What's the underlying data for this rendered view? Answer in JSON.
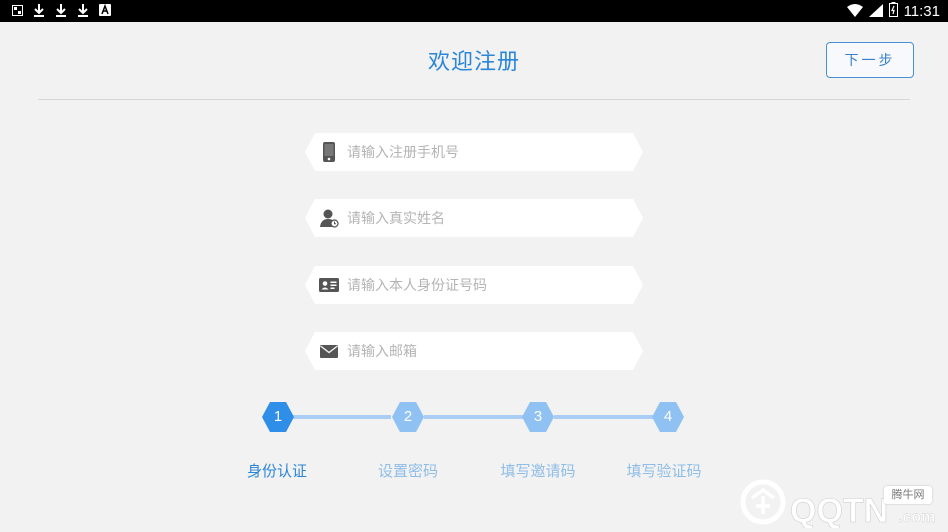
{
  "status_bar": {
    "time": "11:31",
    "left_icons": [
      "sim-icon",
      "download-icon",
      "download-icon",
      "download-icon",
      "app-icon"
    ],
    "right_icons": [
      "wifi-icon",
      "signal-icon",
      "battery-icon"
    ]
  },
  "header": {
    "title": "欢迎注册",
    "next_label": "下一步"
  },
  "form": {
    "phone_placeholder": "请输入注册手机号",
    "name_placeholder": "请输入真实姓名",
    "id_placeholder": "请输入本人身份证号码",
    "email_placeholder": "请输入邮箱"
  },
  "steps": [
    {
      "number": "1",
      "label": "身份认证",
      "active": true
    },
    {
      "number": "2",
      "label": "设置密码",
      "active": false
    },
    {
      "number": "3",
      "label": "填写邀请码",
      "active": false
    },
    {
      "number": "4",
      "label": "填写验证码",
      "active": false
    }
  ],
  "watermark": {
    "brand": "QQTN",
    "suffix": ".com",
    "badge": "腾牛网"
  },
  "colors": {
    "accent": "#2a86d8",
    "step_active": "#2f8ee8",
    "step_inactive": "#8fc1f2",
    "line": "#a9cdf5"
  }
}
